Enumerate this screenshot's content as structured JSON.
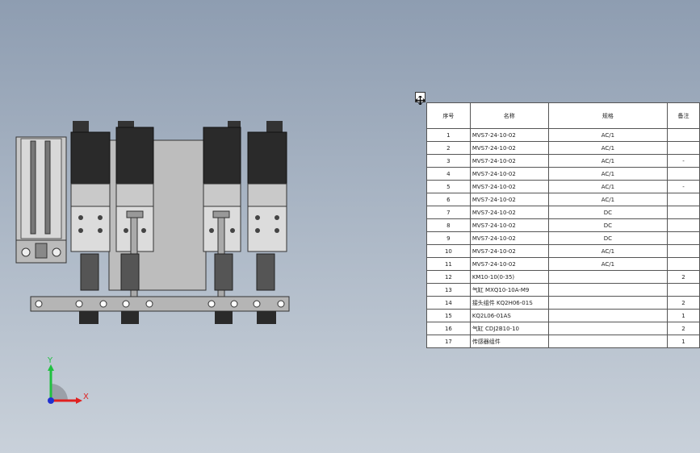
{
  "bom": {
    "headers": [
      "序号",
      "名称",
      "规格",
      "备注"
    ],
    "rows": [
      [
        "1",
        "MVS7-24-10-02",
        "AC/1",
        ""
      ],
      [
        "2",
        "MVS7-24-10-02",
        "AC/1",
        ""
      ],
      [
        "3",
        "MVS7-24-10-02",
        "AC/1",
        "-"
      ],
      [
        "4",
        "MVS7-24-10-02",
        "AC/1",
        ""
      ],
      [
        "5",
        "MVS7-24-10-02",
        "AC/1",
        "-"
      ],
      [
        "6",
        "MVS7-24-10-02",
        "AC/1",
        ""
      ],
      [
        "7",
        "MVS7-24-10-02",
        "DC",
        ""
      ],
      [
        "8",
        "MVS7-24-10-02",
        "DC",
        ""
      ],
      [
        "9",
        "MVS7-24-10-02",
        "DC",
        ""
      ],
      [
        "10",
        "MVS7-24-10-02",
        "AC/1",
        ""
      ],
      [
        "11",
        "MVS7-24-10-02",
        "AC/1",
        ""
      ],
      [
        "12",
        "KM10-10(0-35)",
        "",
        "2"
      ],
      [
        "13",
        "气缸 MXQ10-10A-M9",
        "",
        ""
      ],
      [
        "14",
        "接头组件 KQ2H06-01S",
        "",
        "2"
      ],
      [
        "15",
        "KQ2L06-01AS",
        "",
        "1"
      ],
      [
        "16",
        "气缸 CDJ2B10-10",
        "",
        "2"
      ],
      [
        "17",
        "传感器组件",
        "",
        "1"
      ]
    ]
  },
  "triad": {
    "x_label": "X",
    "y_label": "Y",
    "x_color": "#e02020",
    "y_color": "#20c040",
    "z_color": "#2030d0"
  }
}
